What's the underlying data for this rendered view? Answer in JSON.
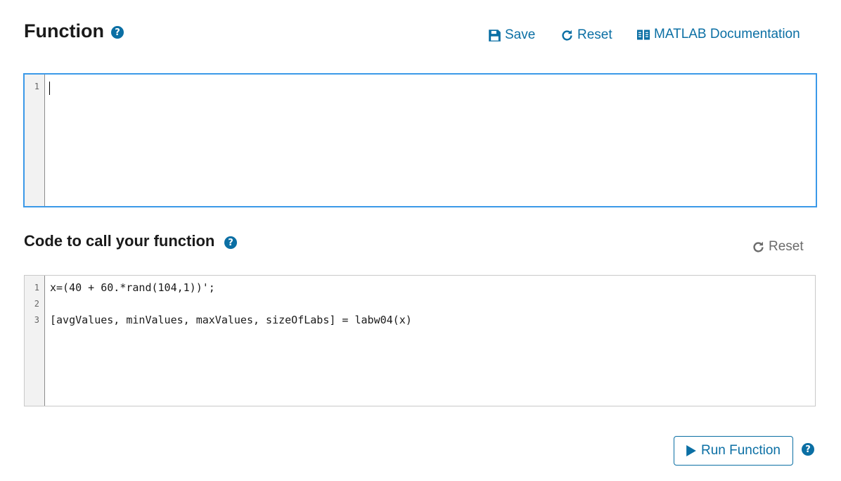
{
  "function_section": {
    "title": "Function",
    "help_icon": "question-circle-icon",
    "toolbar": {
      "save_label": "Save",
      "save_icon": "floppy-disk-icon",
      "reset_label": "Reset",
      "reset_icon": "refresh-icon",
      "doc_label": "MATLAB Documentation",
      "doc_icon": "book-icon"
    },
    "editor": {
      "line_numbers": [
        "1"
      ],
      "lines": [
        ""
      ],
      "focused": true
    }
  },
  "call_section": {
    "title": "Code to call your function",
    "help_icon": "question-circle-icon",
    "reset_label": "Reset",
    "editor": {
      "line_numbers": [
        "1",
        "2",
        "3"
      ],
      "lines": [
        "x=(40 + 60.*rand(104,1))';",
        "",
        "[avgValues, minValues, maxValues, sizeOfLabs] = labw04(x)"
      ]
    }
  },
  "run": {
    "label": "Run Function",
    "icon": "play-icon",
    "help_icon": "question-circle-icon"
  },
  "colors": {
    "accent": "#0b6fa4",
    "focus_border": "#3b99e8",
    "muted": "#6b6b6b"
  }
}
